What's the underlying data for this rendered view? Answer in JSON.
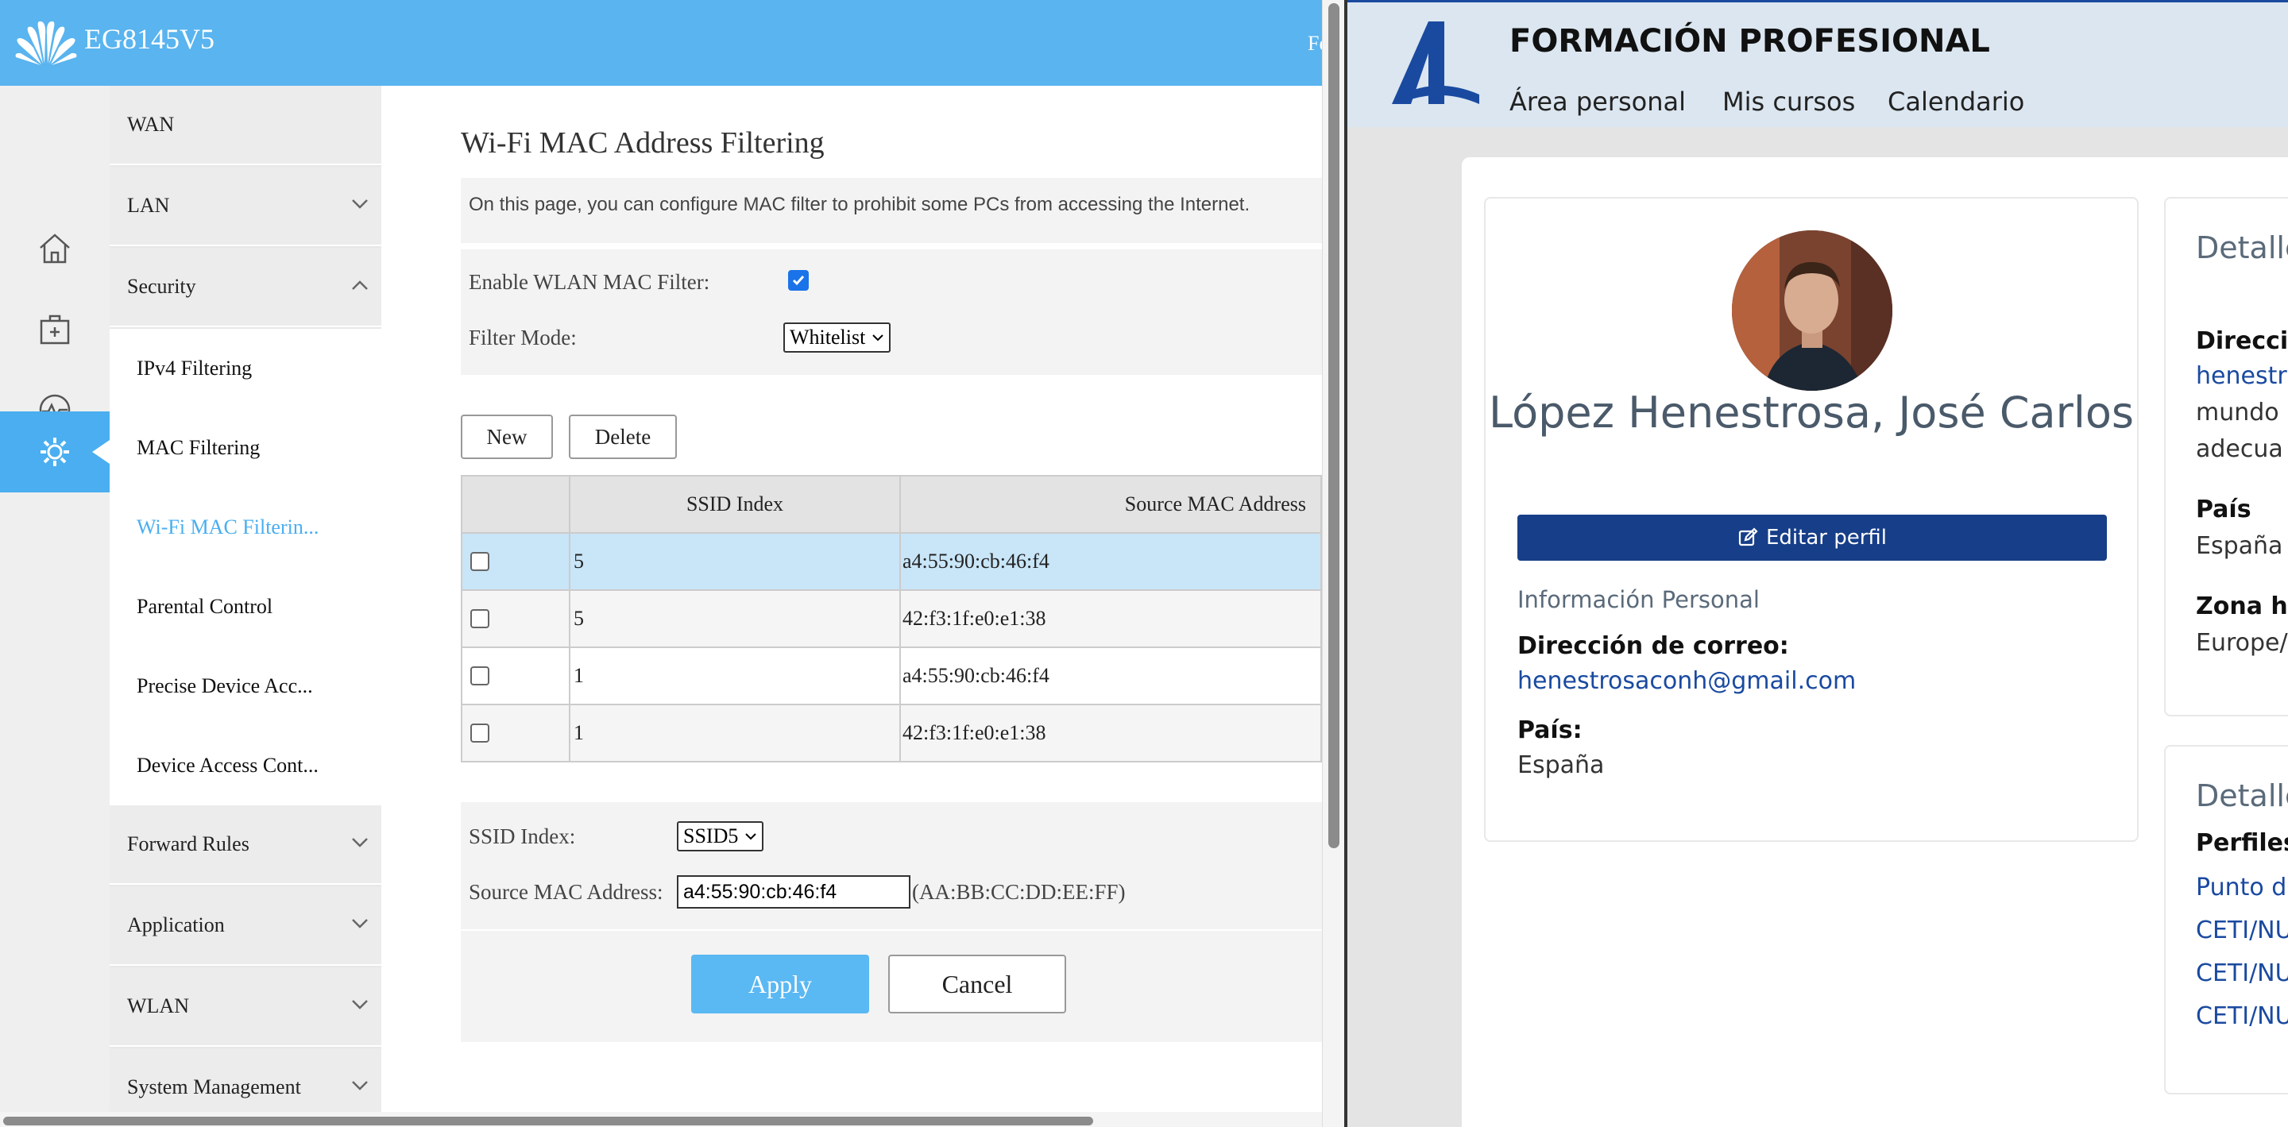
{
  "router": {
    "device_name": "EG8145V5",
    "header_user_partial": "Fe",
    "menu": {
      "wan": "WAN",
      "lan": "LAN",
      "security": "Security",
      "sub_items": [
        "IPv4 Filtering",
        "MAC Filtering",
        "Wi-Fi MAC Filterin...",
        "Parental Control",
        "Precise Device Acc...",
        "Device Access Cont..."
      ],
      "forward_rules": "Forward Rules",
      "application": "Application",
      "wlan": "WLAN",
      "system_management": "System Management"
    },
    "page": {
      "title": "Wi-Fi MAC Address Filtering",
      "description": "On this page, you can configure MAC filter to prohibit some PCs from accessing the Internet.",
      "enable_label": "Enable WLAN MAC Filter:",
      "enable_checked": true,
      "filter_mode_label": "Filter Mode:",
      "filter_mode_value": "Whitelist",
      "new_label": "New",
      "delete_label": "Delete",
      "table": {
        "headers": [
          "SSID Index",
          "Source MAC Address"
        ],
        "rows": [
          {
            "ssid": "5",
            "mac": "a4:55:90:cb:46:f4"
          },
          {
            "ssid": "5",
            "mac": "42:f3:1f:e0:e1:38"
          },
          {
            "ssid": "1",
            "mac": "a4:55:90:cb:46:f4"
          },
          {
            "ssid": "1",
            "mac": "42:f3:1f:e0:e1:38"
          }
        ]
      },
      "ssid_index_label": "SSID Index:",
      "ssid_index_value": "SSID5",
      "source_mac_label": "Source MAC Address:",
      "source_mac_value": "a4:55:90:cb:46:f4",
      "mac_format_hint": "(AA:BB:CC:DD:EE:FF)",
      "apply_label": "Apply",
      "cancel_label": "Cancel"
    },
    "colors": {
      "header": "#59b4ef",
      "accent": "#4aaef0"
    }
  },
  "moodle": {
    "site_name": "FORMACIÓN PROFESIONAL",
    "nav": [
      "Área personal",
      "Mis cursos",
      "Calendario"
    ],
    "profile": {
      "full_name": "López Henestrosa, José Carlos",
      "edit_button": "Editar perfil",
      "section_title": "Información Personal",
      "email_label": "Dirección de correo:",
      "email_value": "henestrosaconh@gmail.com",
      "country_label": "País:",
      "country_value": "España"
    },
    "details_card": {
      "title_partial": "Detalle",
      "address_label_partial": "Direcció",
      "text_lines": [
        "henestr",
        "mundo",
        "adecua"
      ],
      "country_label": "País",
      "country_value": "España",
      "timezone_label_partial": "Zona ho",
      "timezone_value_partial": "Europe/"
    },
    "details_card2": {
      "title_partial": "Detalle",
      "profiles_label": "Perfiles",
      "links": [
        "Punto d",
        "CETI/NU",
        "CETI/NU",
        "CETI/NU"
      ]
    },
    "colors": {
      "primary": "#173e88",
      "link": "#1a4aa0"
    }
  }
}
